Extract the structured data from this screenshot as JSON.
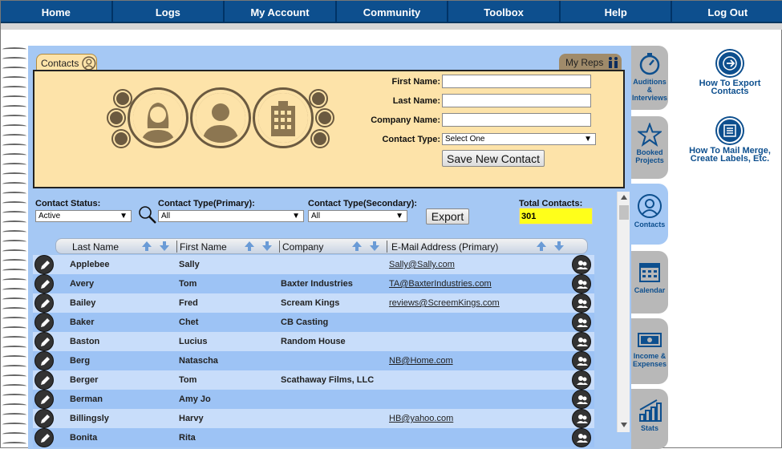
{
  "nav": {
    "items": [
      "Home",
      "Logs",
      "My Account",
      "Community",
      "Toolbox",
      "Help",
      "Log Out"
    ]
  },
  "tabs": {
    "contacts": "Contacts",
    "my_reps": "My Reps"
  },
  "form": {
    "first_name_label": "First Name:",
    "last_name_label": "Last Name:",
    "company_name_label": "Company Name:",
    "contact_type_label": "Contact Type:",
    "first_name_value": "",
    "last_name_value": "",
    "company_name_value": "",
    "contact_type_value": "Select One",
    "save_button": "Save New Contact"
  },
  "filters": {
    "status_label": "Contact Status:",
    "status_value": "Active",
    "primary_label": "Contact Type(Primary):",
    "primary_value": "All",
    "secondary_label": "Contact Type(Secondary):",
    "secondary_value": "All",
    "export_button": "Export",
    "total_label": "Total Contacts:",
    "total_value": "301"
  },
  "table": {
    "columns": [
      "Last Name",
      "First Name",
      "Company",
      "E-Mail Address (Primary)"
    ],
    "rows": [
      {
        "last": "Applebee",
        "first": "Sally",
        "company": "",
        "email": "Sally@Sally.com"
      },
      {
        "last": "Avery",
        "first": "Tom",
        "company": "Baxter Industries",
        "email": "TA@BaxterIndustries.com"
      },
      {
        "last": "Bailey",
        "first": "Fred",
        "company": "Scream Kings",
        "email": "reviews@ScreemKings.com"
      },
      {
        "last": "Baker",
        "first": "Chet",
        "company": "CB Casting",
        "email": ""
      },
      {
        "last": "Baston",
        "first": "Lucius",
        "company": "Random House",
        "email": ""
      },
      {
        "last": "Berg",
        "first": "Natascha",
        "company": "",
        "email": "NB@Home.com"
      },
      {
        "last": "Berger",
        "first": "Tom",
        "company": "Scathaway Films, LLC",
        "email": ""
      },
      {
        "last": "Berman",
        "first": "Amy Jo",
        "company": "",
        "email": ""
      },
      {
        "last": "Billingsly",
        "first": "Harvy",
        "company": "",
        "email": "HB@yahoo.com"
      },
      {
        "last": "Bonita",
        "first": "Rita",
        "company": "",
        "email": ""
      }
    ]
  },
  "side_tabs": [
    {
      "label": "Auditions & Interviews",
      "icon": "stopwatch-icon"
    },
    {
      "label": "Booked Projects",
      "icon": "star-icon"
    },
    {
      "label": "Contacts",
      "icon": "contacts-icon"
    },
    {
      "label": "Calendar",
      "icon": "calendar-icon"
    },
    {
      "label": "Income & Expenses",
      "icon": "money-icon"
    },
    {
      "label": "Stats",
      "icon": "stats-icon"
    }
  ],
  "help_links": [
    {
      "label": "How To Export Contacts",
      "icon": "export-icon"
    },
    {
      "label": "How To Mail Merge, Create Labels, Etc.",
      "icon": "mail-merge-icon"
    }
  ],
  "colors": {
    "nav_bg": "#0d4f8e",
    "panel_bg": "#a5c8f4",
    "form_bg": "#fde3a9",
    "total_bg": "#ffff1a"
  }
}
